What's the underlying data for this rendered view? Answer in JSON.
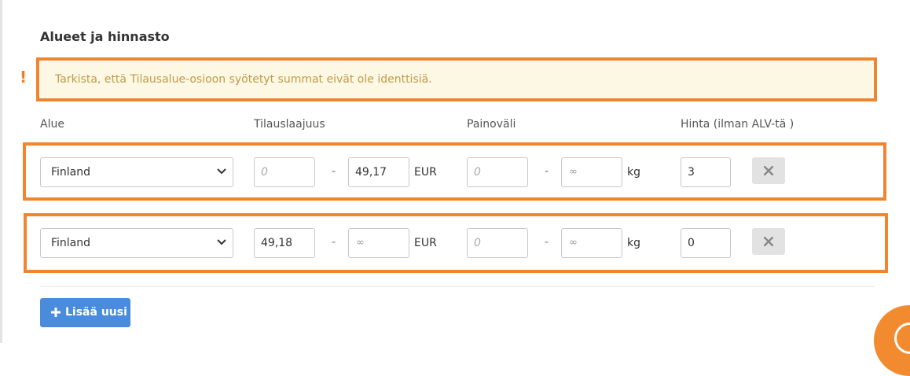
{
  "section": {
    "title": "Alueet ja hinnasto"
  },
  "warning": {
    "icon": "exclamation-icon",
    "text": "Tarkista, että Tilausalue-osioon syötetyt summat eivät ole identtisiä."
  },
  "columns": {
    "region": "Alue",
    "order_range": "Tilauslaajuus",
    "weight_range": "Painoväli",
    "price": "Hinta (ilman ALV-tä )"
  },
  "rows": [
    {
      "region": "Finland",
      "order_from": {
        "value": "",
        "placeholder": "0"
      },
      "order_to": {
        "value": "49,17",
        "placeholder": ""
      },
      "order_unit": "EUR",
      "weight_from": {
        "value": "",
        "placeholder": "0"
      },
      "weight_to": {
        "value": "",
        "placeholder": "∞"
      },
      "weight_unit": "kg",
      "price": "3"
    },
    {
      "region": "Finland",
      "order_from": {
        "value": "49,18",
        "placeholder": ""
      },
      "order_to": {
        "value": "",
        "placeholder": "∞"
      },
      "order_unit": "EUR",
      "weight_from": {
        "value": "",
        "placeholder": "0"
      },
      "weight_to": {
        "value": "",
        "placeholder": "∞"
      },
      "weight_unit": "kg",
      "price": "0"
    }
  ],
  "separator": "-",
  "add_button": {
    "label": "Lisää uusi",
    "icon": "plus-icon"
  },
  "colors": {
    "accent": "#f0852d",
    "primary": "#4a8cdb",
    "warning_bg": "#fcf8e3",
    "warning_text": "#c19a4d"
  }
}
